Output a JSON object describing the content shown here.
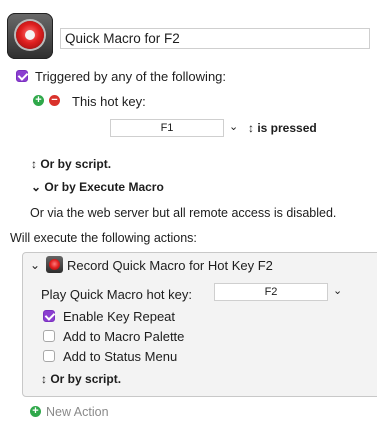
{
  "macro": {
    "name": "Quick Macro for F2",
    "icon": "record-macro-icon"
  },
  "trigger": {
    "header": "Triggered by any of the following:",
    "hotkey_label": "This hot key:",
    "hotkey_value": "F1",
    "hotkey_state": "is pressed",
    "or_by_script": "Or by script.",
    "or_by_execute_macro": "Or by Execute Macro",
    "web_server_note": "Or via the web server but all remote access is disabled."
  },
  "actions": {
    "header": "Will execute the following actions:",
    "action_title": "Record Quick Macro for Hot Key F2",
    "play_label": "Play Quick Macro hot key:",
    "play_value": "F2",
    "options": [
      {
        "label": "Enable Key Repeat",
        "checked": true
      },
      {
        "label": "Add to Macro Palette",
        "checked": false
      },
      {
        "label": "Add to Status Menu",
        "checked": false
      }
    ],
    "or_by_script": "Or by script.",
    "new_action": "New Action"
  },
  "colors": {
    "checkbox_accent": "#8b3fd0",
    "add_green": "#2fa84a",
    "remove_red": "#d9312b"
  }
}
